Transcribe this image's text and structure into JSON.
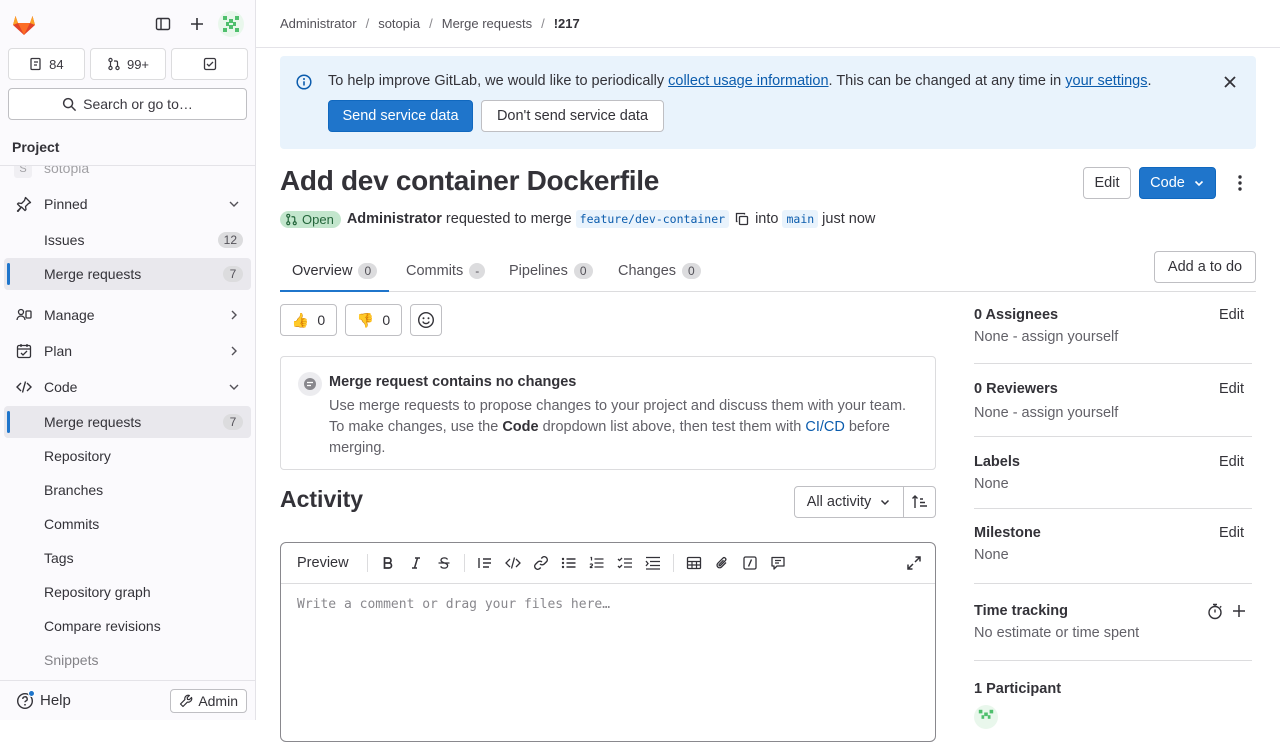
{
  "sidebar": {
    "counts": {
      "issues": "84",
      "merge_requests": "99+"
    },
    "search_label": "Search or go to…",
    "project_heading": "Project",
    "project_name": "sotopia",
    "project_initial": "S",
    "items": [
      {
        "label": "Pinned"
      },
      {
        "label": "Issues",
        "badge": "12"
      },
      {
        "label": "Merge requests",
        "badge": "7"
      },
      {
        "label": "Manage"
      },
      {
        "label": "Plan"
      },
      {
        "label": "Code"
      },
      {
        "label": "Merge requests",
        "badge": "7"
      },
      {
        "label": "Repository"
      },
      {
        "label": "Branches"
      },
      {
        "label": "Commits"
      },
      {
        "label": "Tags"
      },
      {
        "label": "Repository graph"
      },
      {
        "label": "Compare revisions"
      },
      {
        "label": "Snippets"
      }
    ],
    "help_label": "Help",
    "admin_label": "Admin"
  },
  "breadcrumb": [
    "Administrator",
    "sotopia",
    "Merge requests",
    "!217"
  ],
  "banner": {
    "text_1": "To help improve GitLab, we would like to periodically ",
    "link_1": "collect usage information",
    "text_2": ". This can be changed at any time in ",
    "link_2": "your settings",
    "text_3": ".",
    "send_label": "Send service data",
    "dont_send_label": "Don't send service data"
  },
  "mr": {
    "title": "Add dev container Dockerfile",
    "edit_label": "Edit",
    "code_label": "Code",
    "status": "Open",
    "author": "Administrator",
    "requested_text": "requested to merge",
    "source_branch": "feature/dev-container",
    "into_text": "into",
    "target_branch": "main",
    "time": "just now"
  },
  "tabs": [
    {
      "label": "Overview",
      "count": "0"
    },
    {
      "label": "Commits",
      "count": "-"
    },
    {
      "label": "Pipelines",
      "count": "0"
    },
    {
      "label": "Changes",
      "count": "0"
    }
  ],
  "add_todo_label": "Add a to do",
  "reactions": {
    "thumbs_up": "0",
    "thumbs_down": "0",
    "thumbs_up_emoji": "👍",
    "thumbs_down_emoji": "👎"
  },
  "no_changes": {
    "heading": "Merge request contains no changes",
    "text_1": "Use merge requests to propose changes to your project and discuss them with your team. To make changes, use the ",
    "bold": "Code",
    "text_2": " dropdown list above, then test them with ",
    "link": "CI/CD",
    "text_3": " before merging."
  },
  "activity": {
    "heading": "Activity",
    "filter_label": "All activity",
    "preview_label": "Preview",
    "placeholder": "Write a comment or drag your files here…"
  },
  "right_sidebar": [
    {
      "title": "0 Assignees",
      "value": "None - assign yourself",
      "action": "Edit"
    },
    {
      "title": "0 Reviewers",
      "value": "None - assign yourself",
      "action": "Edit"
    },
    {
      "title": "Labels",
      "value": "None",
      "action": "Edit"
    },
    {
      "title": "Milestone",
      "value": "None",
      "action": "Edit"
    },
    {
      "title": "Time tracking",
      "value": "No estimate or time spent"
    },
    {
      "title": "1 Participant"
    }
  ],
  "colors": {
    "accent": "#1f75cb",
    "status_open_bg": "#c3e6cd",
    "status_open_fg": "#24663b",
    "banner_bg": "#e9f3fc",
    "logo": "#e24329"
  }
}
